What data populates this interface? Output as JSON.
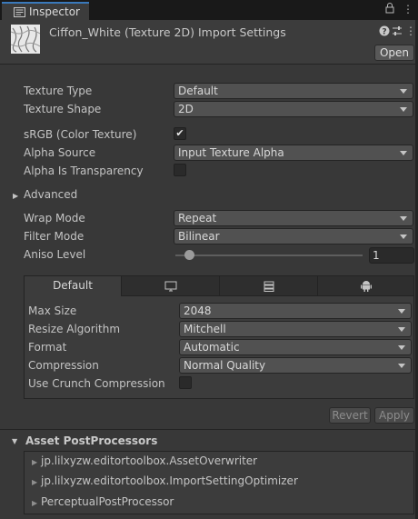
{
  "window": {
    "tab_title": "Inspector",
    "lock_icon": "🔒",
    "menu_icon": "⋮"
  },
  "header": {
    "title": "Ciffon_White (Texture 2D) Import Settings",
    "help_icon": "?",
    "settings_icon": "≡",
    "menu_icon": "⋮",
    "open_label": "Open"
  },
  "properties": {
    "texture_type": {
      "label": "Texture Type",
      "value": "Default"
    },
    "texture_shape": {
      "label": "Texture Shape",
      "value": "2D"
    },
    "srgb": {
      "label": "sRGB (Color Texture)",
      "checked": "✔"
    },
    "alpha_source": {
      "label": "Alpha Source",
      "value": "Input Texture Alpha"
    },
    "alpha_is_transparency": {
      "label": "Alpha Is Transparency"
    },
    "advanced": {
      "label": "Advanced",
      "arrow": "▶"
    },
    "wrap_mode": {
      "label": "Wrap Mode",
      "value": "Repeat"
    },
    "filter_mode": {
      "label": "Filter Mode",
      "value": "Bilinear"
    },
    "aniso_level": {
      "label": "Aniso Level",
      "value": "1",
      "fraction": 0.0
    }
  },
  "platform_panel": {
    "tabs": [
      {
        "label": "Default",
        "icon": ""
      },
      {
        "label": "",
        "icon": "monitor-icon"
      },
      {
        "label": "",
        "icon": "server-icon"
      },
      {
        "label": "",
        "icon": "android-icon"
      }
    ],
    "max_size": {
      "label": "Max Size",
      "value": "2048"
    },
    "resize_algorithm": {
      "label": "Resize Algorithm",
      "value": "Mitchell"
    },
    "format": {
      "label": "Format",
      "value": "Automatic"
    },
    "compression": {
      "label": "Compression",
      "value": "Normal Quality"
    },
    "use_crunch": {
      "label": "Use Crunch Compression"
    }
  },
  "actions": {
    "revert_label": "Revert",
    "apply_label": "Apply"
  },
  "asset_postprocessors": {
    "title": "Asset PostProcessors",
    "arrow": "▼",
    "item_arrow": "▶",
    "items": [
      "jp.lilxyzw.editortoolbox.AssetOverwriter",
      "jp.lilxyzw.editortoolbox.ImportSettingOptimizer",
      "PerceptualPostProcessor"
    ]
  },
  "colors": {
    "accent": "#3a79bb",
    "background": "#383838",
    "field": "#515151"
  }
}
